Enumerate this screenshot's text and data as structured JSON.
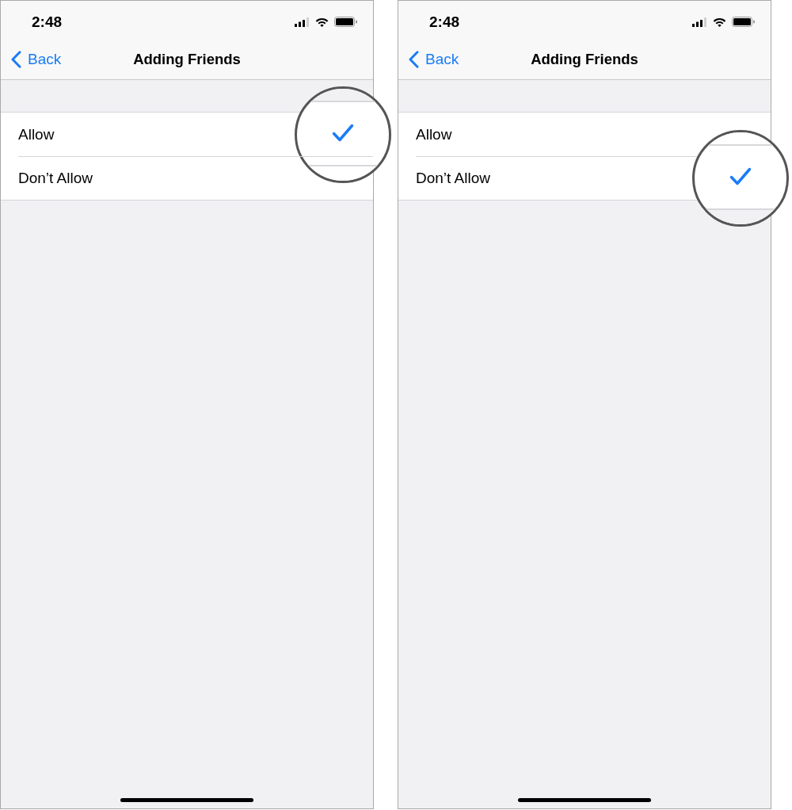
{
  "screens": [
    {
      "status_bar": {
        "time": "2:48"
      },
      "nav_bar": {
        "back": "Back",
        "title": "Adding Friends"
      },
      "options": [
        {
          "label": "Allow",
          "selected": true,
          "magnified": true
        },
        {
          "label": "Don’t Allow",
          "selected": false,
          "magnified": false
        }
      ]
    },
    {
      "status_bar": {
        "time": "2:48"
      },
      "nav_bar": {
        "back": "Back",
        "title": "Adding Friends"
      },
      "options": [
        {
          "label": "Allow",
          "selected": false,
          "magnified": false
        },
        {
          "label": "Don’t Allow",
          "selected": true,
          "magnified": true
        }
      ]
    }
  ]
}
